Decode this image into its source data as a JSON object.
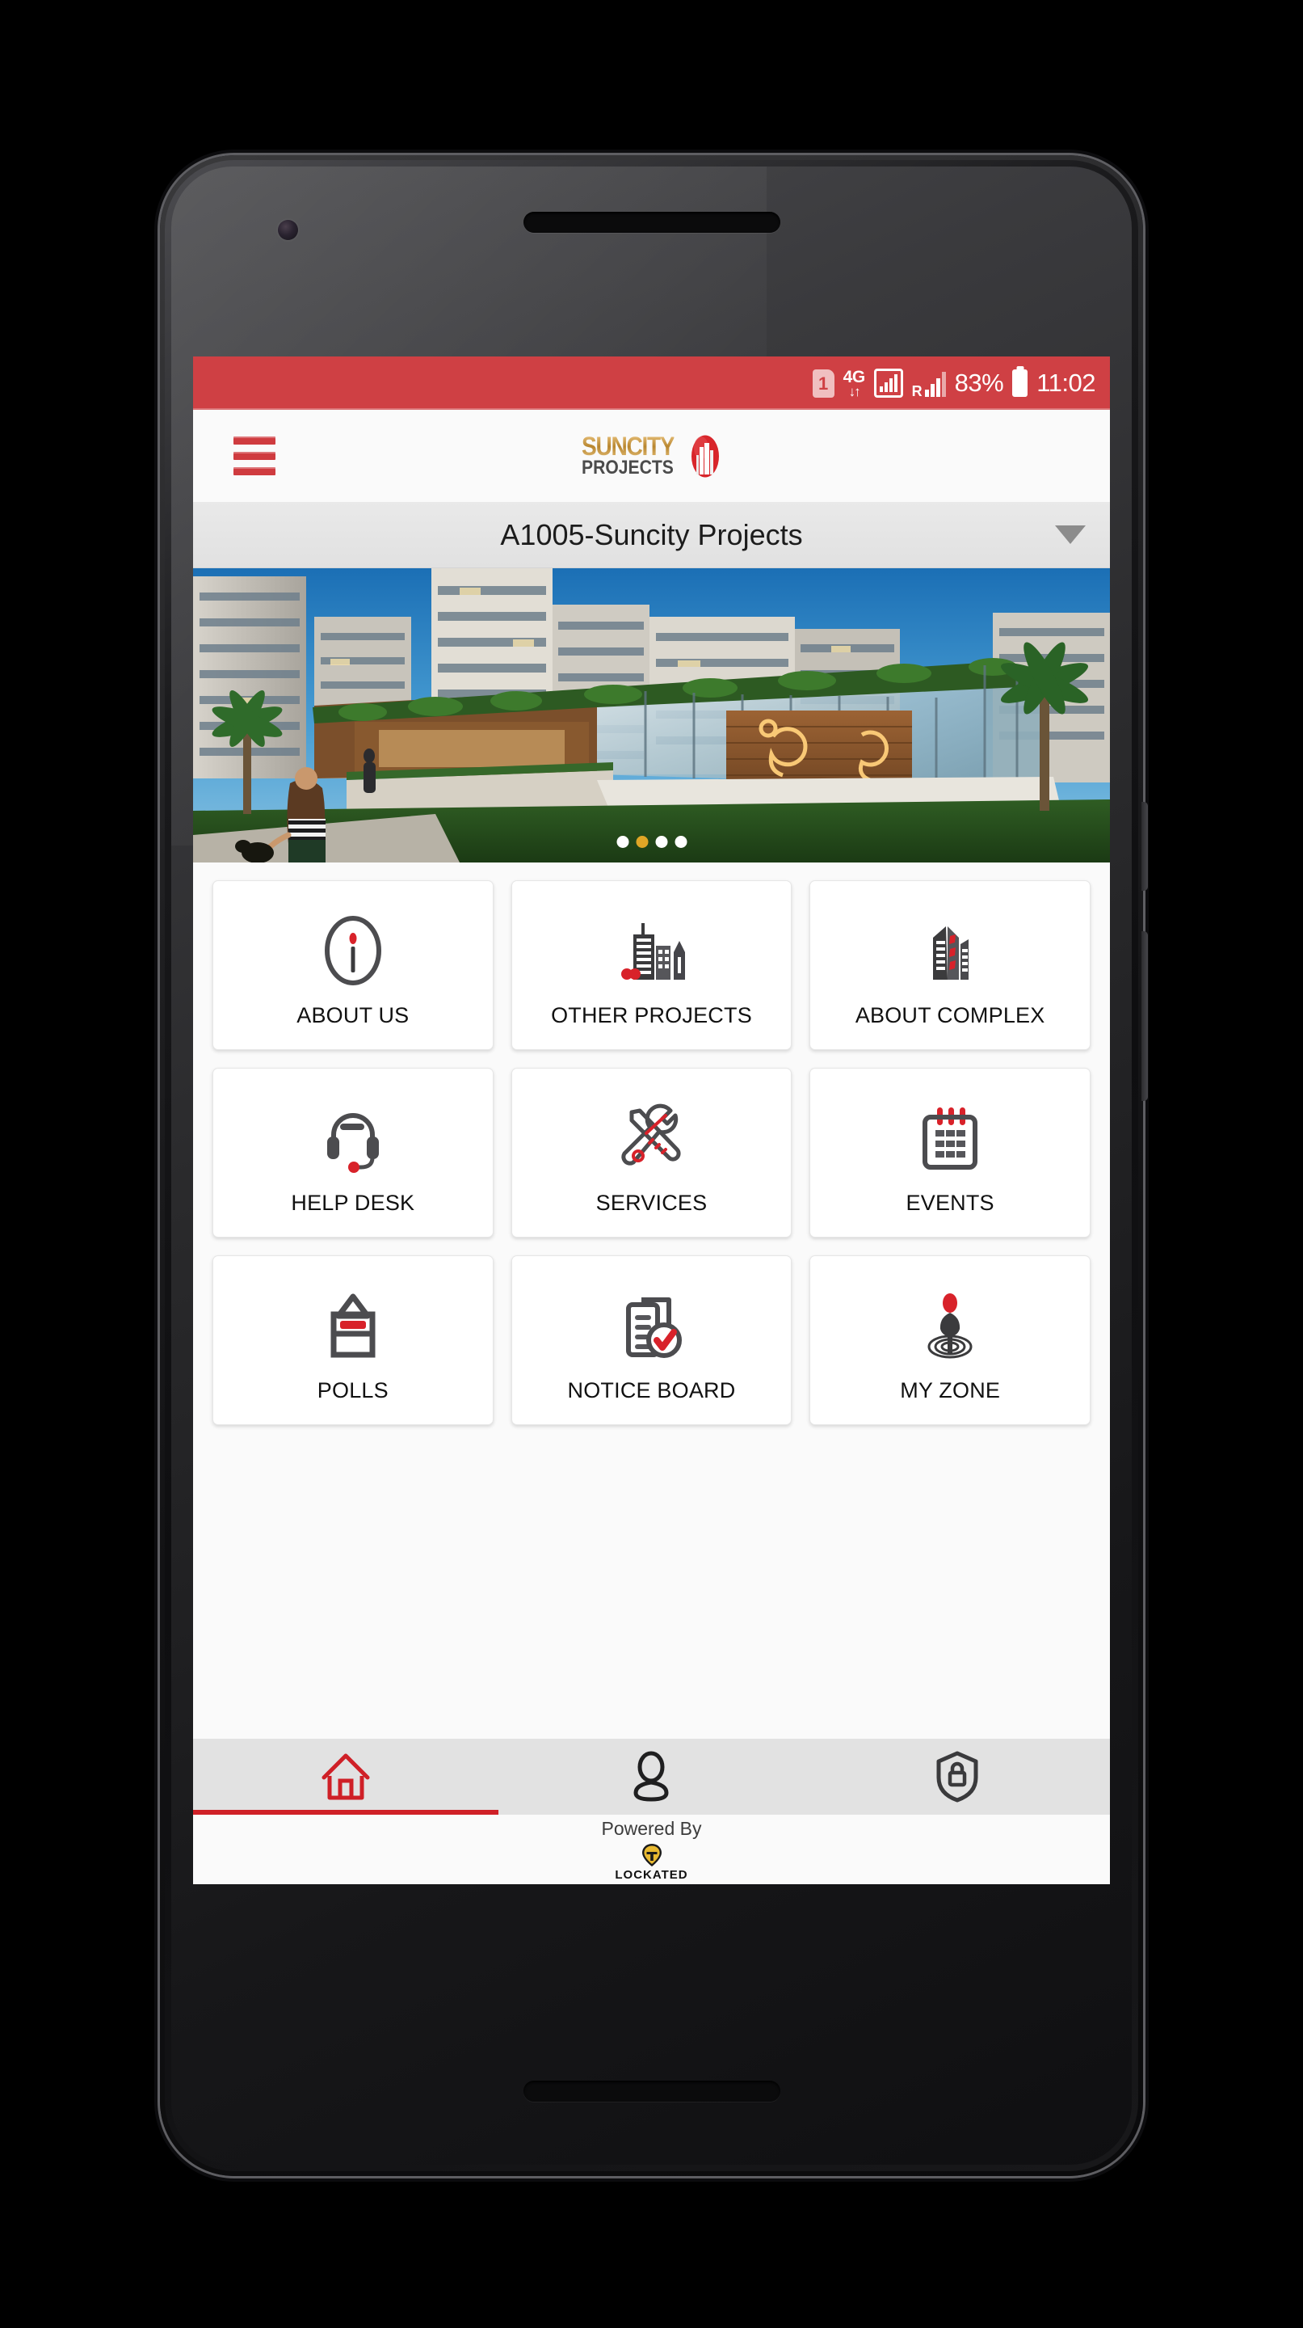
{
  "device": {
    "name": "android-phone-mockup"
  },
  "status_bar": {
    "background": "#cf4044",
    "sim_label": "1",
    "network_type": "4G",
    "data_arrows": "↓↑",
    "roaming_label": "R",
    "battery_percent": "83%",
    "clock": "11:02"
  },
  "app_bar": {
    "menu_icon": "hamburger-icon",
    "brand_primary": "SUNCITY",
    "brand_secondary": "PROJECTS"
  },
  "project_selector": {
    "selected": "A1005-Suncity Projects",
    "caret_icon": "chevron-down-icon"
  },
  "carousel": {
    "alt": "Residential complex clubhouse rendering",
    "slide_count": 4,
    "active_index": 1,
    "active_dot_color": "#e0a626",
    "dot_color": "#ffffff"
  },
  "grid": {
    "tiles": [
      {
        "label": "ABOUT US",
        "icon": "info-circle-icon"
      },
      {
        "label": "OTHER PROJECTS",
        "icon": "buildings-icon"
      },
      {
        "label": "ABOUT COMPLEX",
        "icon": "complex-buildings-icon"
      },
      {
        "label": "HELP DESK",
        "icon": "headset-icon"
      },
      {
        "label": "SERVICES",
        "icon": "tools-icon"
      },
      {
        "label": "EVENTS",
        "icon": "calendar-icon"
      },
      {
        "label": "POLLS",
        "icon": "ballot-box-icon"
      },
      {
        "label": "NOTICE BOARD",
        "icon": "clipboard-check-icon"
      },
      {
        "label": "MY ZONE",
        "icon": "location-person-icon"
      }
    ]
  },
  "bottom_nav": {
    "active_color": "#cf2027",
    "items": [
      {
        "icon": "home-icon",
        "active": true
      },
      {
        "icon": "person-icon",
        "active": false
      },
      {
        "icon": "shield-lock-icon",
        "active": false
      }
    ]
  },
  "footer": {
    "powered_by": "Powered By",
    "vendor": "LOCKATED",
    "vendor_icon": "lockated-pin-icon"
  }
}
